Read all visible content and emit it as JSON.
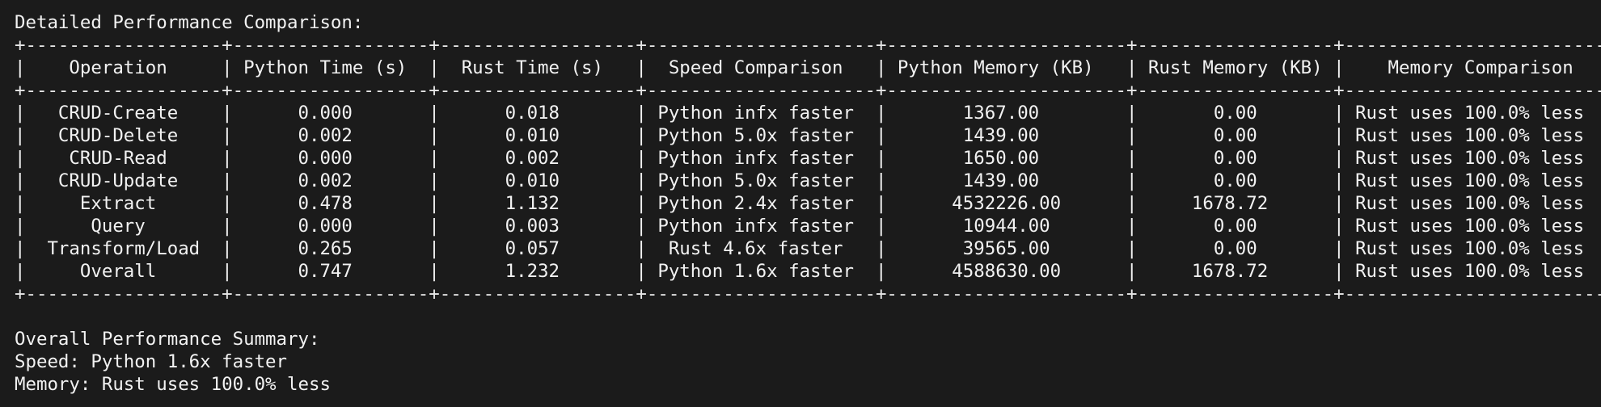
{
  "title": "Detailed Performance Comparison:",
  "table": {
    "border_line": "+------------------+------------------+------------------+---------------------+----------------------+------------------+-------------------------+",
    "header_line": "|    Operation     | Python Time (s)  |  Rust Time (s)   |  Speed Comparison   | Python Memory (KB)   | Rust Memory (KB) |    Memory Comparison    |",
    "rows": [
      "|   CRUD-Create    |      0.000       |      0.018       | Python infx faster  |       1367.00        |       0.00       | Rust uses 100.0% less   |",
      "|   CRUD-Delete    |      0.002       |      0.010       | Python 5.0x faster  |       1439.00        |       0.00       | Rust uses 100.0% less   |",
      "|    CRUD-Read     |      0.000       |      0.002       | Python infx faster  |       1650.00        |       0.00       | Rust uses 100.0% less   |",
      "|   CRUD-Update    |      0.002       |      0.010       | Python 5.0x faster  |       1439.00        |       0.00       | Rust uses 100.0% less   |",
      "|     Extract      |      0.478       |      1.132       | Python 2.4x faster  |      4532226.00      |     1678.72      | Rust uses 100.0% less   |",
      "|      Query       |      0.000       |      0.003       | Python infx faster  |       10944.00       |       0.00       | Rust uses 100.0% less   |",
      "|  Transform/Load  |      0.265       |      0.057       |  Rust 4.6x faster   |       39565.00       |       0.00       | Rust uses 100.0% less   |",
      "|     Overall      |      0.747       |      1.232       | Python 1.6x faster  |      4588630.00      |     1678.72      | Rust uses 100.0% less   |"
    ]
  },
  "summary": {
    "heading": "Overall Performance Summary:",
    "speed": "Speed: Python 1.6x faster",
    "memory": "Memory: Rust uses 100.0% less"
  }
}
